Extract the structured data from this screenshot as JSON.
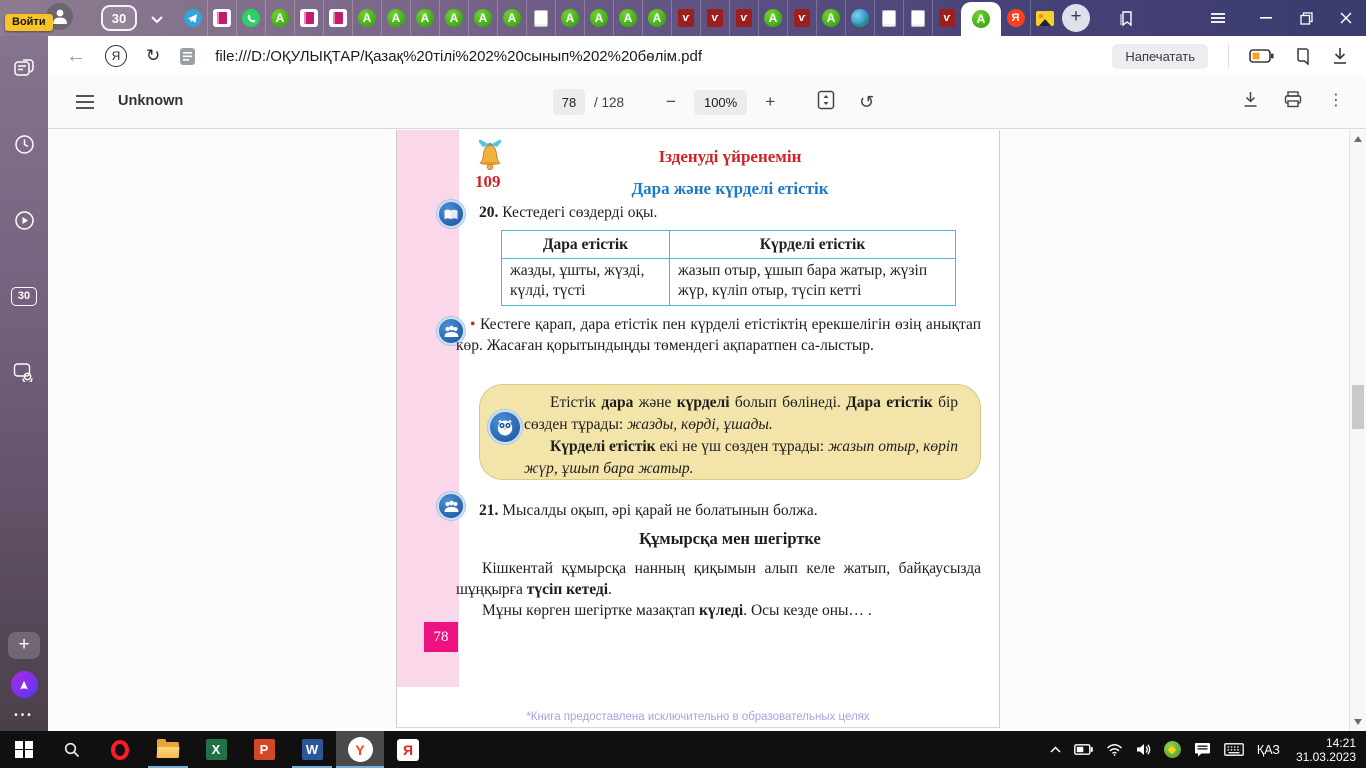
{
  "tabbar": {
    "login_button": "Войти",
    "tab_counter": "30",
    "tabs": [
      "telegram",
      "book-pink",
      "whatsapp",
      "green-a",
      "book-pink",
      "book-pink",
      "green-a",
      "green-a",
      "green-a",
      "green-a",
      "green-a",
      "green-a",
      "doc",
      "green-a",
      "green-a",
      "green-a",
      "green-a",
      "red-v",
      "red-v",
      "red-v",
      "green-a",
      "red-v",
      "green-a",
      "globe",
      "doc",
      "doc",
      "red-v",
      "green-a-active",
      "yandex",
      "image"
    ]
  },
  "toolbar": {
    "url": "file:///D:/ОҚУЛЫҚТАР/Қазақ%20тілі%202%20сынып%202%20бөлім.pdf",
    "print_button": "Напечатать"
  },
  "pdf_toolbar": {
    "title": "Unknown",
    "current_page": "78",
    "total_pages": "/ 128",
    "zoom": "100%"
  },
  "icons": {
    "back": "←",
    "refresh": "↻",
    "yandex_letter": "Я",
    "minus": "−",
    "plus": "+",
    "rotate_ccw": "↺",
    "kebab": "⋮",
    "new_tab": "+",
    "sidebar_plus": "+",
    "sidebar_dots": "•••",
    "red_v_glyph": "ѵ",
    "green_a_glyph": "A",
    "taskbar_excel": "X",
    "taskbar_powerpoint": "P",
    "taskbar_word": "W",
    "taskbar_ybrowser": "Y",
    "taskbar_yapp": "Я"
  },
  "colors": {
    "accent_magenta": "#ec1380",
    "table_border": "#49b9d3",
    "title_red": "#cf2229",
    "title_blue": "#1e78c8",
    "rule_box_fill": "#f3e4a9",
    "pink_strip": "#fbd7ea",
    "login_badge": "#f6c426"
  },
  "book_page": {
    "lesson_number": "109",
    "header_title": "Ізденуді үйренемін",
    "lesson_title": "Дара және күрделі етістік",
    "exercise20": [
      {
        "t": "20.",
        "b": true
      },
      {
        "t": " Кестедегі сөздерді оқы."
      }
    ],
    "table": {
      "headers": [
        "Дара етістік",
        "Күрделі етістік"
      ],
      "row": [
        "жазды, ұшты, жүзді, күлді, түсті",
        "жазып отыр, ұшып бара жатыр, жүзіп жүр, күліп отыр, түсіп кетті"
      ]
    },
    "bullet_paragraph": [
      {
        "t": "• ",
        "c": "#cc2222"
      },
      {
        "t": "Кестеге қарап, дара етістік пен күрделі етістіктің ерекшелігін өзің анықтап көр. Жасаған қорытындыңды төмендегі ақпаратпен са-лыстыр."
      }
    ],
    "rule_p1": [
      {
        "t": "Етістік "
      },
      {
        "t": "дара",
        "b": true
      },
      {
        "t": " және "
      },
      {
        "t": "күрделі",
        "b": true
      },
      {
        "t": " болып бөлінеді. "
      },
      {
        "t": "Дара етістік",
        "b": true
      },
      {
        "t": " бір сөзден тұрады: "
      },
      {
        "t": "жазды, көрді, ұшады.",
        "i": true
      }
    ],
    "rule_p2": [
      {
        "t": "Күрделі етістік",
        "b": true
      },
      {
        "t": " екі не үш сөзден тұрады: "
      },
      {
        "t": "жазып отыр, көріп жүр, ұшып бара жатыр.",
        "i": true
      }
    ],
    "exercise21": [
      {
        "t": "21.",
        "b": true
      },
      {
        "t": " Мысалды оқып, әрі қарай не болатынын болжа."
      }
    ],
    "story_title": "Құмырсқа мен шегіртке",
    "story_p1": [
      {
        "t": "Кішкентай құмырсқа нанның қиқымын алып келе жатып, байқаусызда шұңқырға "
      },
      {
        "t": "түсіп кетеді",
        "b": true
      },
      {
        "t": "."
      }
    ],
    "story_p2": [
      {
        "t": "Мұны көрген шегіртке мазақтап "
      },
      {
        "t": "күледі",
        "b": true
      },
      {
        "t": ". Осы кезде оны… ."
      }
    ],
    "page_number": "78",
    "footer_note": "*Книга предоставлена исключительно в образовательных целях"
  },
  "sidebar": {
    "tab_counter": "30"
  },
  "taskbar": {
    "apps": [
      {
        "id": "start"
      },
      {
        "id": "search"
      },
      {
        "id": "opera"
      },
      {
        "id": "explorer",
        "running": true
      },
      {
        "id": "excel"
      },
      {
        "id": "powerpoint"
      },
      {
        "id": "word",
        "running": true
      },
      {
        "id": "yandex-browser",
        "running": true,
        "active": true
      },
      {
        "id": "yandex-app"
      }
    ],
    "language": "ҚАЗ",
    "time": "14:21",
    "date": "31.03.2023"
  }
}
